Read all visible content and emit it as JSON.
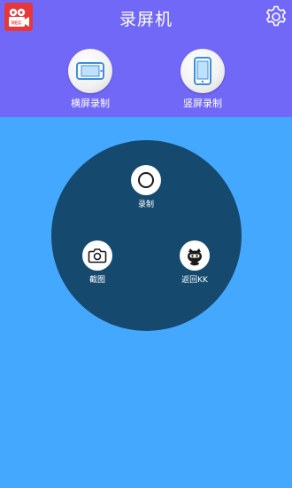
{
  "header": {
    "title": "录屏机",
    "logo_icon": "video-camera-rec-icon",
    "settings_icon": "gear-icon",
    "background_color": "#7268f7"
  },
  "modes": {
    "landscape_label": "横屏录制",
    "landscape_icon": "phone-landscape-icon",
    "portrait_label": "竖屏录制",
    "portrait_icon": "phone-portrait-icon"
  },
  "controls": {
    "record_label": "录制",
    "record_icon": "record-circle-icon",
    "screenshot_label": "截图",
    "screenshot_icon": "camera-icon",
    "back_label": "返回KK",
    "back_icon": "kk-mascot-icon",
    "disc_color": "#154a6e"
  },
  "page": {
    "background_color": "#45a8ff"
  }
}
